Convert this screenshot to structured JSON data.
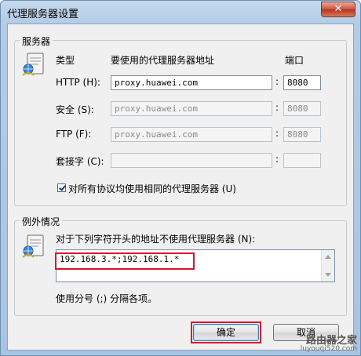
{
  "window": {
    "title": "代理服务器设置",
    "close_label": "✕"
  },
  "servers": {
    "group_title": "服务器",
    "header_type": "类型",
    "header_address": "要使用的代理服务器地址",
    "header_port": "端口",
    "rows": [
      {
        "label": "HTTP (H):",
        "address": "proxy.huawei.com",
        "port": "8080",
        "enabled": true
      },
      {
        "label": "安全 (S):",
        "address": "proxy.huawei.com",
        "port": "8080",
        "enabled": false
      },
      {
        "label": "FTP (F):",
        "address": "proxy.huawei.com",
        "port": "8080",
        "enabled": false
      },
      {
        "label": "套接字 (C):",
        "address": "",
        "port": "",
        "enabled": false
      }
    ],
    "same_proxy_label": "对所有协议均使用相同的代理服务器 (U)",
    "same_proxy_checked": true
  },
  "exceptions": {
    "group_title": "例外情况",
    "description": "对于下列字符开头的地址不使用代理服务器 (N):",
    "value": "192.168.3.*;192.168.1.*",
    "hint": "使用分号 (;) 分隔各项。"
  },
  "buttons": {
    "ok": "确定",
    "cancel": "取消"
  },
  "watermark": {
    "main": "路由器之家",
    "url": "luyouqi520.com"
  },
  "colors": {
    "highlight": "#e0102a",
    "title_bar": "#b3cbe6"
  }
}
